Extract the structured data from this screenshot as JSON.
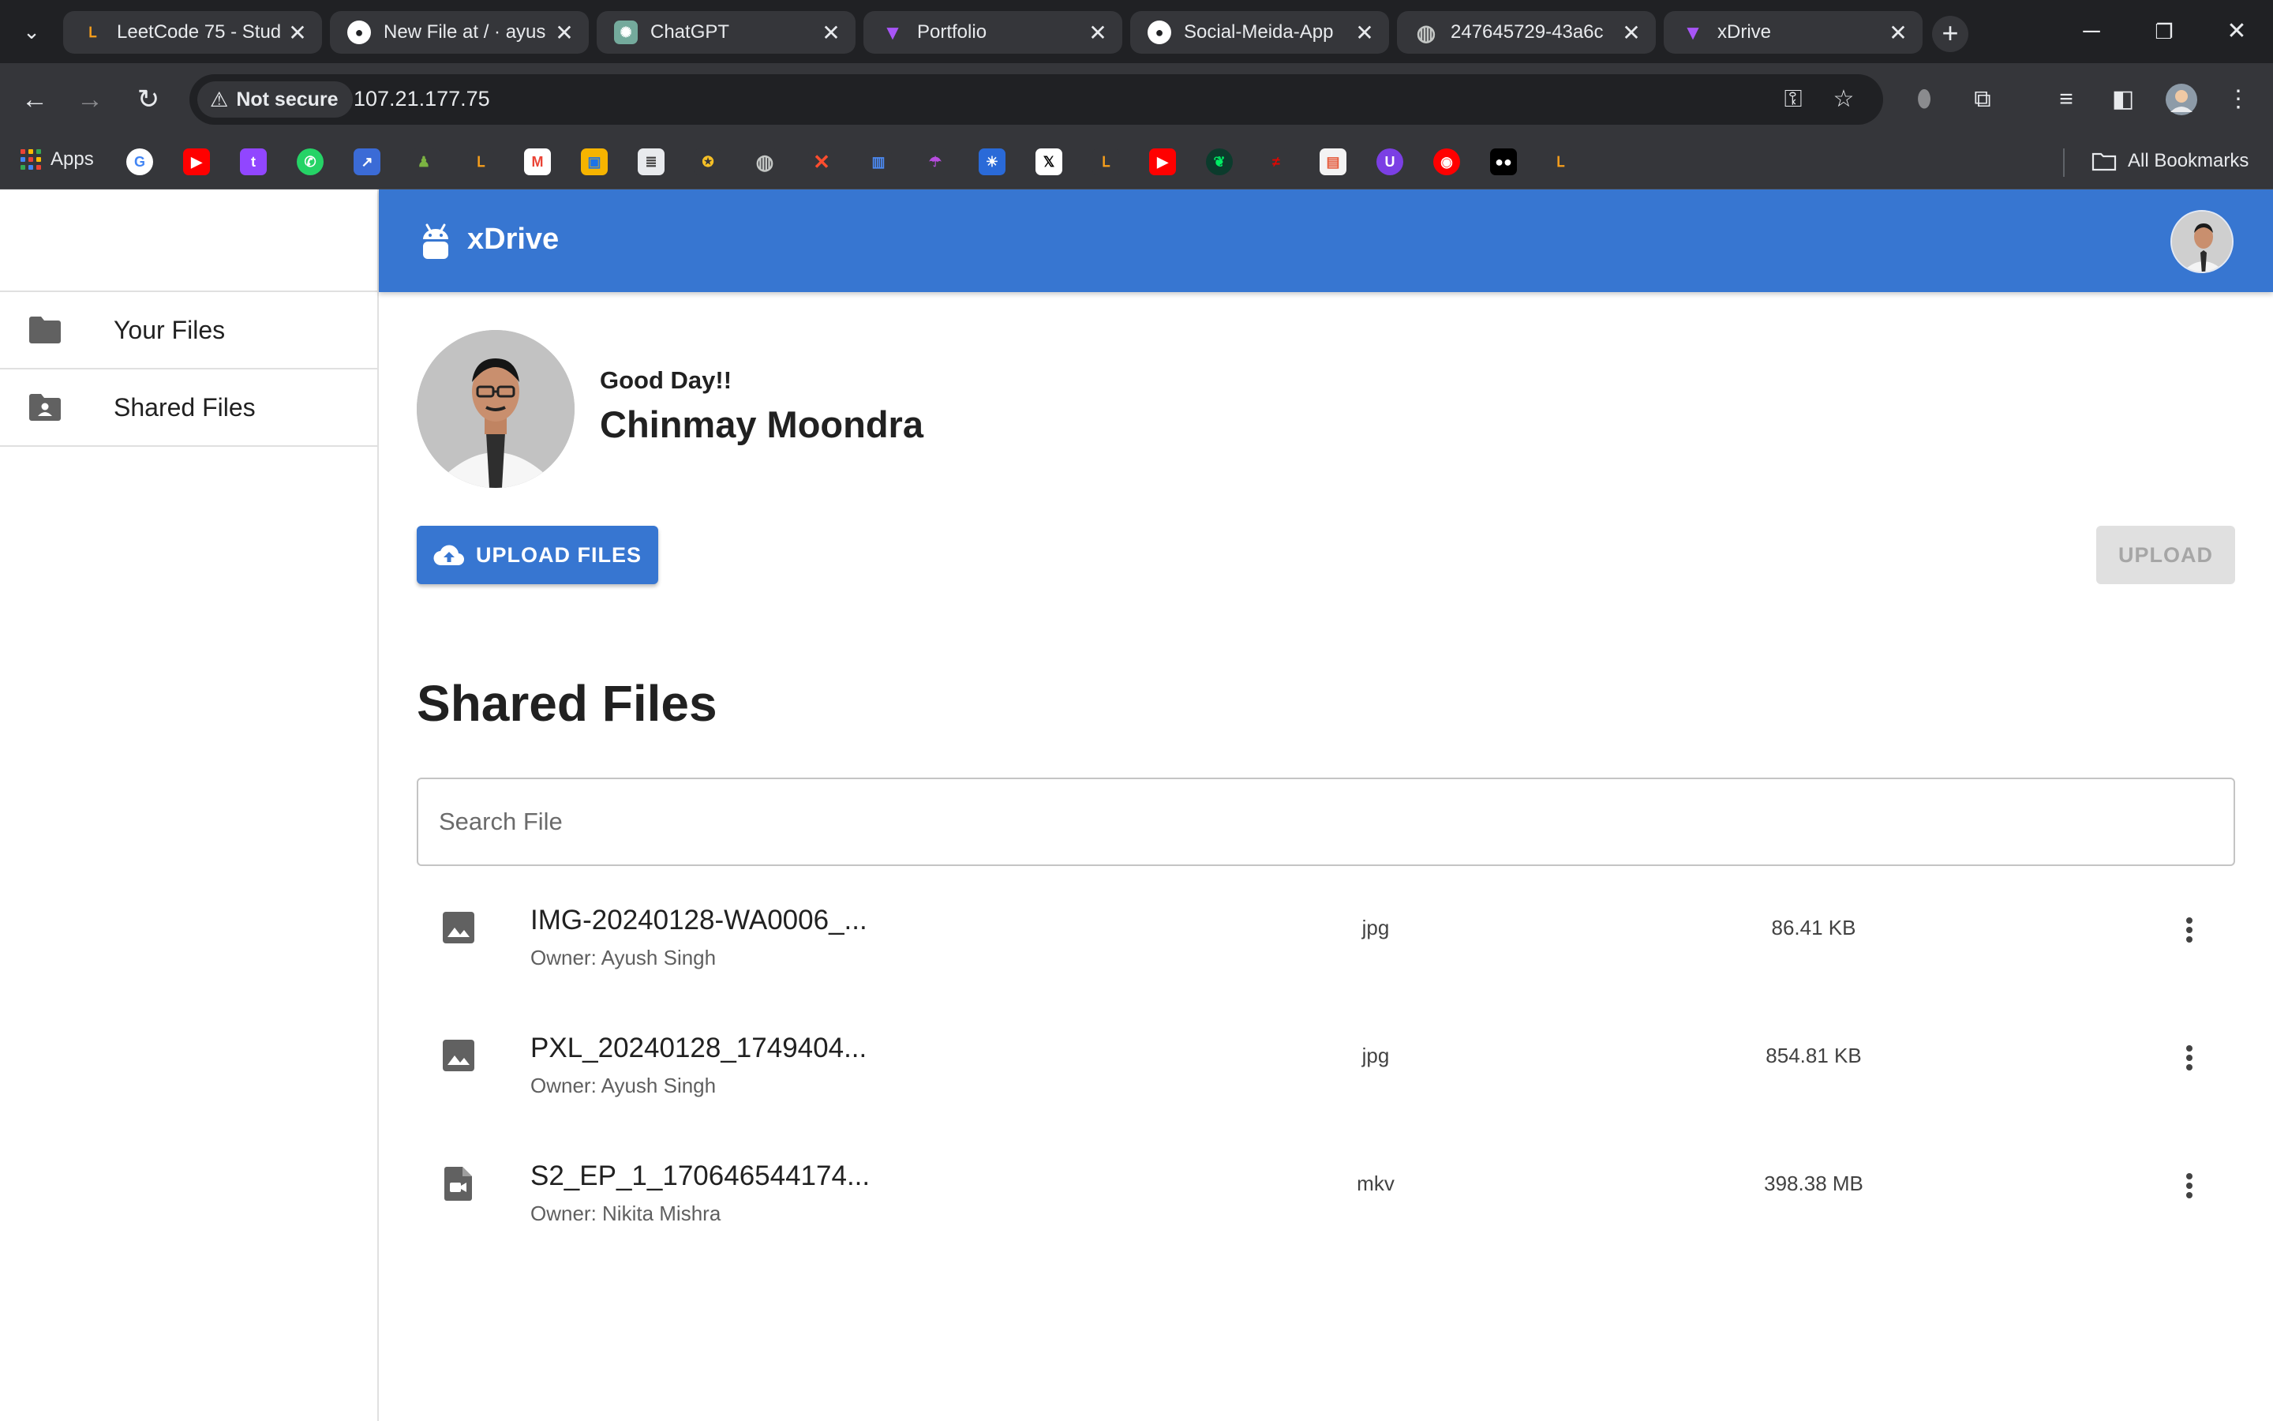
{
  "browser": {
    "tabs": [
      {
        "title": "LeetCode 75 - Stud",
        "icon": "leetcode-icon",
        "color": "#f89f1b"
      },
      {
        "title": "New File at / · ayus",
        "icon": "github-icon",
        "color": "#ffffff"
      },
      {
        "title": "ChatGPT",
        "icon": "chatgpt-icon",
        "color": "#74aa9c"
      },
      {
        "title": "Portfolio",
        "icon": "vite-icon",
        "color": "#a855f7"
      },
      {
        "title": "Social-Meida-App",
        "icon": "github-icon",
        "color": "#ffffff"
      },
      {
        "title": "247645729-43a6c",
        "icon": "globe-icon",
        "color": "#c4c7c5"
      },
      {
        "title": "xDrive",
        "icon": "vite-icon",
        "color": "#a855f7"
      }
    ],
    "address_bar": {
      "security_label": "Not secure",
      "url": "107.21.177.75"
    },
    "bookmarks": {
      "apps_label": "Apps",
      "all_bookmarks_label": "All Bookmarks"
    }
  },
  "app": {
    "brand": "xDrive",
    "accent_color": "#3776d1",
    "sidebar": {
      "items": [
        {
          "label": "Your Files",
          "icon": "folder-icon"
        },
        {
          "label": "Shared Files",
          "icon": "shared-folder-icon"
        }
      ]
    },
    "profile": {
      "greeting": "Good Day!!",
      "name": "Chinmay Moondra"
    },
    "actions": {
      "upload_files_label": "UPLOAD FILES",
      "upload_label": "UPLOAD"
    },
    "section_title": "Shared Files",
    "search": {
      "placeholder": "Search File",
      "value": ""
    },
    "files": [
      {
        "name": "IMG-20240128-WA0006_...",
        "owner": "Owner: Ayush Singh",
        "type": "jpg",
        "size": "86.41 KB",
        "icon": "image-icon"
      },
      {
        "name": "PXL_20240128_1749404...",
        "owner": "Owner: Ayush Singh",
        "type": "jpg",
        "size": "854.81 KB",
        "icon": "image-icon"
      },
      {
        "name": "S2_EP_1_170646544174...",
        "owner": "Owner: Nikita Mishra",
        "type": "mkv",
        "size": "398.38 MB",
        "icon": "video-file-icon"
      }
    ]
  }
}
